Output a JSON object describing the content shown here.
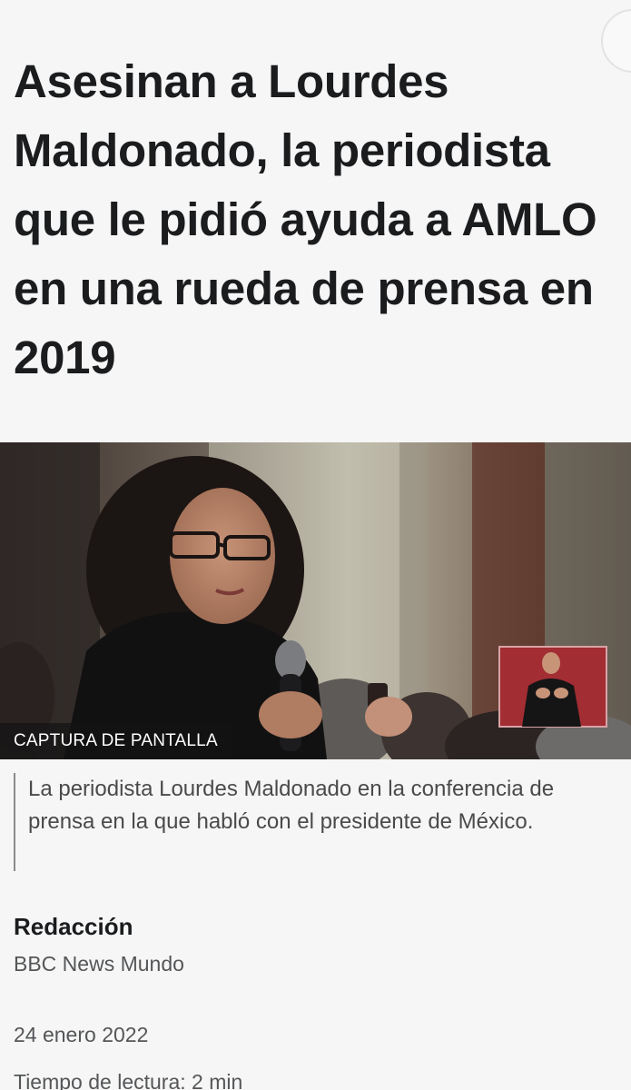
{
  "article": {
    "headline": "Asesinan a Lourdes Maldonado, la periodista que le pidió ayuda a AMLO en una rueda de prensa en 2019",
    "image": {
      "credit": "CAPTURA DE PANTALLA"
    },
    "caption": "La periodista Lourdes Maldonado en la conferencia de prensa en la que habló con el presidente de México.",
    "byline": {
      "author": "Redacción",
      "organization": "BBC News Mundo"
    },
    "date": "24 enero 2022",
    "reading_time": "Tiempo de lectura: 2 min"
  }
}
